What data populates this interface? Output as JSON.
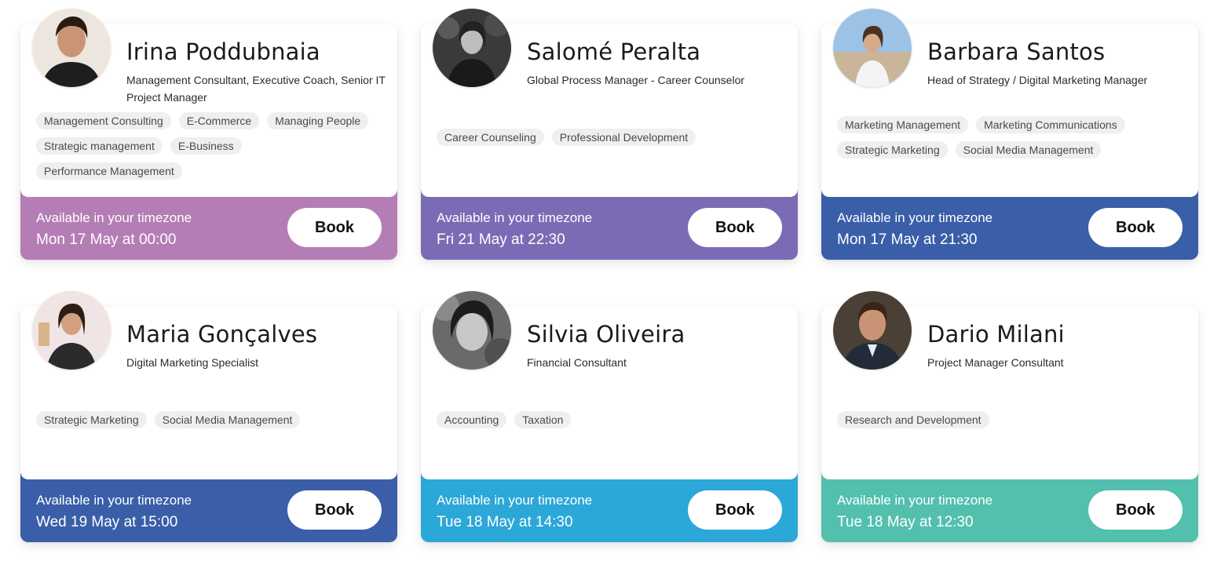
{
  "consultants": [
    {
      "name": "Irina Poddubnaia",
      "title": "Management Consultant, Executive Coach, Senior IT Project Manager",
      "tags": [
        "Management Consulting",
        "E-Commerce",
        "Managing People",
        "Strategic management",
        "E-Business",
        "Performance Management"
      ],
      "availability_label": "Available in your timezone",
      "date": "Mon 17 May at 00:00",
      "book_label": "Book",
      "footer_color": "#b57db5",
      "avatar_icon": "portrait-photo"
    },
    {
      "name": "Salomé Peralta",
      "title": "Global Process Manager - Career Counselor",
      "tags": [
        "Career Counseling",
        "Professional Development"
      ],
      "availability_label": "Available in your timezone",
      "date": "Fri 21 May at 22:30",
      "book_label": "Book",
      "footer_color": "#7b6bb5",
      "avatar_icon": "portrait-photo"
    },
    {
      "name": "Barbara Santos",
      "title": "Head of Strategy / Digital Marketing Manager",
      "tags": [
        "Marketing Management",
        "Marketing Communications",
        "Strategic Marketing",
        "Social Media Management"
      ],
      "availability_label": "Available in your timezone",
      "date": "Mon 17 May at 21:30",
      "book_label": "Book",
      "footer_color": "#3a5ea8",
      "avatar_icon": "portrait-photo"
    },
    {
      "name": "Maria Gonçalves",
      "title": "Digital Marketing Specialist",
      "tags": [
        "Strategic Marketing",
        "Social Media Management"
      ],
      "availability_label": "Available in your timezone",
      "date": "Wed 19 May at 15:00",
      "book_label": "Book",
      "footer_color": "#3a5ea8",
      "avatar_icon": "portrait-photo"
    },
    {
      "name": "Silvia Oliveira",
      "title": "Financial Consultant",
      "tags": [
        "Accounting",
        "Taxation"
      ],
      "availability_label": "Available in your timezone",
      "date": "Tue 18 May at 14:30",
      "book_label": "Book",
      "footer_color": "#2ba7d8",
      "avatar_icon": "portrait-photo"
    },
    {
      "name": "Dario Milani",
      "title": "Project Manager Consultant",
      "tags": [
        "Research and Development"
      ],
      "availability_label": "Available in your timezone",
      "date": "Tue 18 May at 12:30",
      "book_label": "Book",
      "footer_color": "#52c0ad",
      "avatar_icon": "portrait-photo"
    }
  ]
}
